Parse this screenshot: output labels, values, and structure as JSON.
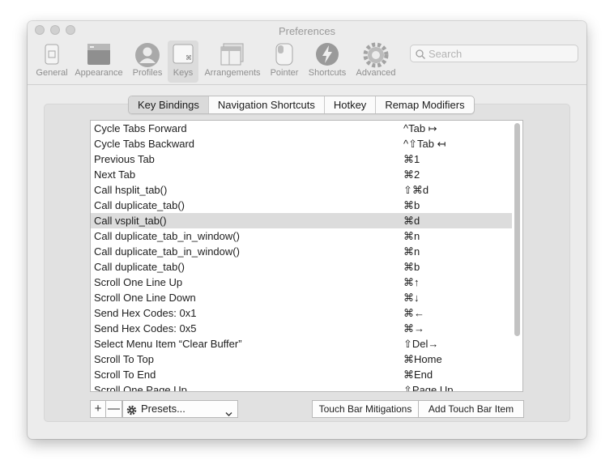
{
  "window": {
    "title": "Preferences"
  },
  "toolbar": {
    "items": [
      {
        "label": "General",
        "icon": "general-icon"
      },
      {
        "label": "Appearance",
        "icon": "appearance-icon"
      },
      {
        "label": "Profiles",
        "icon": "profiles-icon"
      },
      {
        "label": "Keys",
        "icon": "keys-icon",
        "selected": true
      },
      {
        "label": "Arrangements",
        "icon": "arrangements-icon"
      },
      {
        "label": "Pointer",
        "icon": "pointer-icon"
      },
      {
        "label": "Shortcuts",
        "icon": "shortcuts-icon"
      },
      {
        "label": "Advanced",
        "icon": "advanced-icon"
      }
    ]
  },
  "search": {
    "placeholder": "Search"
  },
  "tabs": [
    {
      "label": "Key Bindings",
      "selected": true
    },
    {
      "label": "Navigation Shortcuts"
    },
    {
      "label": "Hotkey"
    },
    {
      "label": "Remap Modifiers"
    }
  ],
  "bindings": [
    {
      "action": "Cycle Tabs Forward",
      "shortcut": "^Tab ↦"
    },
    {
      "action": "Cycle Tabs Backward",
      "shortcut": "^⇧Tab ↤"
    },
    {
      "action": "Previous Tab",
      "shortcut": "⌘1"
    },
    {
      "action": "Next Tab",
      "shortcut": "⌘2"
    },
    {
      "action": "Call hsplit_tab()",
      "shortcut": "⇧⌘d"
    },
    {
      "action": "Call duplicate_tab()",
      "shortcut": "⌘b"
    },
    {
      "action": "Call vsplit_tab()",
      "shortcut": "⌘d",
      "selected": true
    },
    {
      "action": "Call duplicate_tab_in_window()",
      "shortcut": "⌘n"
    },
    {
      "action": "Call duplicate_tab_in_window()",
      "shortcut": "⌘n"
    },
    {
      "action": "Call duplicate_tab()",
      "shortcut": "⌘b"
    },
    {
      "action": "Scroll One Line Up",
      "shortcut": "⌘↑"
    },
    {
      "action": "Scroll One Line Down",
      "shortcut": "⌘↓"
    },
    {
      "action": "Send Hex Codes: 0x1",
      "shortcut": "⌘←"
    },
    {
      "action": "Send Hex Codes: 0x5",
      "shortcut": "⌘→"
    },
    {
      "action": "Select Menu Item “Clear Buffer”",
      "shortcut": "⇧Del→"
    },
    {
      "action": "Scroll To Top",
      "shortcut": "⌘Home"
    },
    {
      "action": "Scroll To End",
      "shortcut": "⌘End"
    },
    {
      "action": "Scroll One Page Up",
      "shortcut": "⇧Page Up"
    }
  ],
  "bottom": {
    "add_label": "+",
    "remove_label": "—",
    "presets_label": "Presets...",
    "touchbar_mitigations_label": "Touch Bar Mitigations",
    "add_touchbar_label": "Add Touch Bar Item"
  }
}
